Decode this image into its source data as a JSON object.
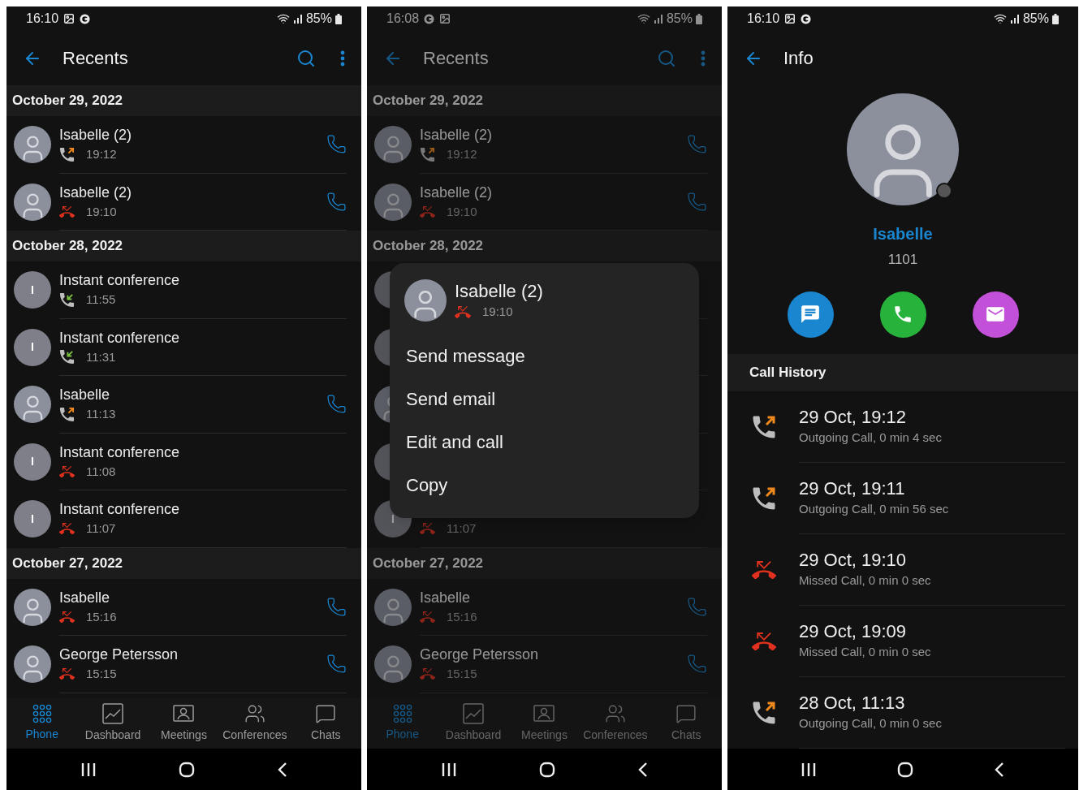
{
  "screens": [
    {
      "kind": "recents",
      "dimmed": false,
      "status_bar": {
        "time": "16:10",
        "notifications": [
          {
            "kind": "image"
          },
          {
            "kind": "g"
          }
        ],
        "battery": "85%"
      },
      "title": "Recents",
      "sections": [
        {
          "date": "October 29, 2022",
          "calls": [
            {
              "kind": "contact",
              "avatar": {
                "kind": "photo"
              },
              "name": "Isabelle (2)",
              "direction": {
                "kind": "outgoing"
              },
              "time": "19:12",
              "call_button": true
            },
            {
              "kind": "contact",
              "avatar": {
                "kind": "photo"
              },
              "name": "Isabelle (2)",
              "direction": {
                "kind": "missed"
              },
              "time": "19:10",
              "call_button": true
            }
          ]
        },
        {
          "date": "October 28, 2022",
          "calls": [
            {
              "kind": "contact",
              "avatar": {
                "kind": "initial",
                "initial": "I"
              },
              "name": "Instant conference",
              "direction": {
                "kind": "incoming"
              },
              "time": "11:55",
              "call_button": false
            },
            {
              "kind": "contact",
              "avatar": {
                "kind": "initial",
                "initial": "I"
              },
              "name": "Instant conference",
              "direction": {
                "kind": "incoming"
              },
              "time": "11:31",
              "call_button": false
            },
            {
              "kind": "contact",
              "avatar": {
                "kind": "photo"
              },
              "name": "Isabelle",
              "direction": {
                "kind": "outgoing"
              },
              "time": "11:13",
              "call_button": true
            },
            {
              "kind": "contact",
              "avatar": {
                "kind": "initial",
                "initial": "I"
              },
              "name": "Instant conference",
              "direction": {
                "kind": "missed"
              },
              "time": "11:08",
              "call_button": false
            },
            {
              "kind": "contact",
              "avatar": {
                "kind": "initial",
                "initial": "I"
              },
              "name": "Instant conference",
              "direction": {
                "kind": "missed"
              },
              "time": "11:07",
              "call_button": false
            }
          ]
        },
        {
          "date": "October 27, 2022",
          "calls": [
            {
              "kind": "contact",
              "avatar": {
                "kind": "photo"
              },
              "name": "Isabelle",
              "direction": {
                "kind": "missed"
              },
              "time": "15:16",
              "call_button": true
            },
            {
              "kind": "contact",
              "avatar": {
                "kind": "photo"
              },
              "name": "George Petersson",
              "direction": {
                "kind": "missed"
              },
              "time": "15:15",
              "call_button": true
            }
          ]
        }
      ],
      "tabs": [
        {
          "label": "Phone",
          "selected": true
        },
        {
          "label": "Dashboard",
          "selected": false
        },
        {
          "label": "Meetings",
          "selected": false
        },
        {
          "label": "Conferences",
          "selected": false
        },
        {
          "label": "Chats",
          "selected": false
        }
      ]
    },
    {
      "kind": "recents",
      "dimmed": true,
      "status_bar": {
        "time": "16:08",
        "notifications": [
          {
            "kind": "g"
          },
          {
            "kind": "image"
          }
        ],
        "battery": "85%"
      },
      "title": "Recents",
      "sections": [
        {
          "date": "October 29, 2022",
          "calls": [
            {
              "kind": "contact",
              "avatar": {
                "kind": "photo"
              },
              "name": "Isabelle (2)",
              "direction": {
                "kind": "outgoing"
              },
              "time": "19:12",
              "call_button": true
            },
            {
              "kind": "contact",
              "avatar": {
                "kind": "photo"
              },
              "name": "Isabelle (2)",
              "direction": {
                "kind": "missed"
              },
              "time": "19:10",
              "call_button": true
            }
          ]
        },
        {
          "date": "October 28, 2022",
          "calls": [
            {
              "kind": "covered",
              "avatar": {
                "kind": "initial"
              }
            },
            {
              "kind": "covered",
              "avatar": {
                "kind": "initial"
              }
            },
            {
              "kind": "covered",
              "avatar": {
                "kind": "photo"
              }
            },
            {
              "kind": "covered",
              "avatar": {
                "kind": "initial"
              }
            },
            {
              "kind": "contact",
              "avatar": {
                "kind": "initial",
                "initial": "I"
              },
              "direction": {
                "kind": "missed"
              },
              "time": "11:07",
              "call_button": false
            }
          ]
        },
        {
          "date": "October 27, 2022",
          "calls": [
            {
              "kind": "contact",
              "avatar": {
                "kind": "photo"
              },
              "name": "Isabelle",
              "direction": {
                "kind": "missed"
              },
              "time": "15:16",
              "call_button": true
            },
            {
              "kind": "contact",
              "avatar": {
                "kind": "photo"
              },
              "name": "George Petersson",
              "direction": {
                "kind": "missed"
              },
              "time": "15:15",
              "call_button": true
            }
          ]
        }
      ],
      "tabs": [
        {
          "label": "Phone",
          "selected": true
        },
        {
          "label": "Dashboard",
          "selected": false
        },
        {
          "label": "Meetings",
          "selected": false
        },
        {
          "label": "Conferences",
          "selected": false
        },
        {
          "label": "Chats",
          "selected": false
        }
      ],
      "menu": {
        "contact": {
          "name": "Isabelle (2)",
          "direction": {
            "kind": "missed"
          },
          "time": "19:10"
        },
        "items": [
          "Send message",
          "Send email",
          "Edit and call",
          "Copy"
        ]
      }
    },
    {
      "kind": "info",
      "status_bar": {
        "time": "16:10",
        "notifications": [
          {
            "kind": "image"
          },
          {
            "kind": "g"
          }
        ],
        "battery": "85%"
      },
      "title": "Info",
      "contact": {
        "name": "Isabelle",
        "number": "1101"
      },
      "actions": [
        {
          "kind": "message",
          "color": "#1a86d0"
        },
        {
          "kind": "call",
          "color": "#27b33b"
        },
        {
          "kind": "email",
          "color": "#c350d8"
        }
      ],
      "history_title": "Call History",
      "history": [
        {
          "direction": {
            "kind": "outgoing"
          },
          "title": "29 Oct, 19:12",
          "detail": "Outgoing Call, 0 min 4 sec"
        },
        {
          "direction": {
            "kind": "outgoing"
          },
          "title": "29 Oct, 19:11",
          "detail": "Outgoing Call, 0 min 56 sec"
        },
        {
          "direction": {
            "kind": "missed"
          },
          "title": "29 Oct, 19:10",
          "detail": "Missed Call, 0 min 0 sec"
        },
        {
          "direction": {
            "kind": "missed"
          },
          "title": "29 Oct, 19:09",
          "detail": "Missed Call, 0 min 0 sec"
        },
        {
          "direction": {
            "kind": "outgoing"
          },
          "title": "28 Oct, 11:13",
          "detail": "Outgoing Call, 0 min 0 sec"
        }
      ]
    }
  ]
}
